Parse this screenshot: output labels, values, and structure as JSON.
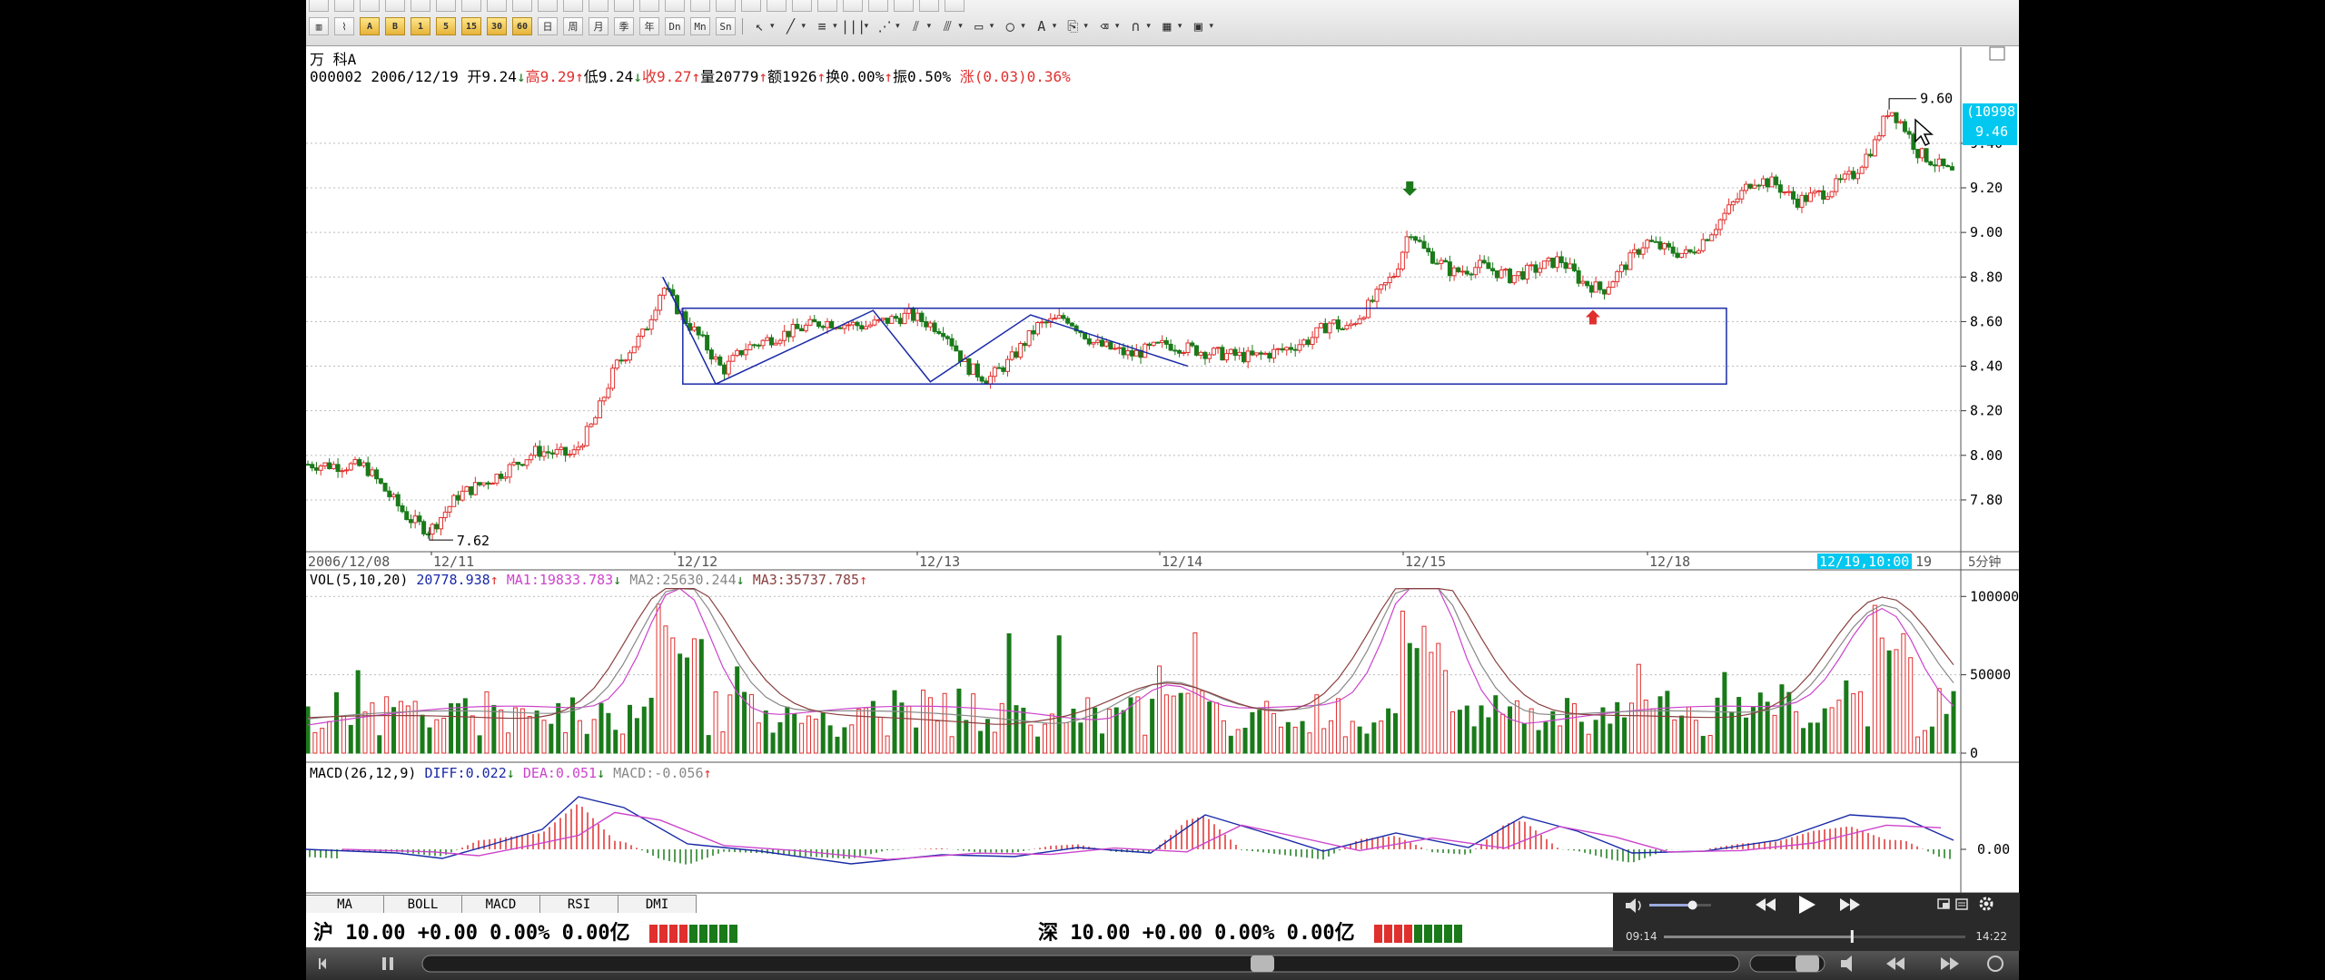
{
  "app": {
    "stock_name": "万 科A",
    "info_code_date": "000002 2006/12/19",
    "info_open": "开9.24",
    "info_high": "高9.29",
    "info_low": "低9.24",
    "info_close": "收9.27",
    "info_volume": "量20779",
    "info_amount": "额1926",
    "info_turnover": "换0.00%",
    "info_amplitude": "振0.50%",
    "info_change": "涨(0.03)0.36%"
  },
  "toolbar": {
    "row2_buttons": [
      "A",
      "B",
      "1",
      "5",
      "15",
      "30",
      "60",
      "日",
      "周",
      "月",
      "季",
      "年",
      "Dn",
      "Mn",
      "Sn"
    ]
  },
  "price_axis": {
    "ticks": [
      "9.40",
      "9.20",
      "9.00",
      "8.80",
      "8.60",
      "8.40",
      "8.20",
      "8.00",
      "7.80"
    ],
    "max_label": "9.60",
    "min_label": "7.62",
    "crosshair_count": "(10998)",
    "crosshair_price": "9.46"
  },
  "time_axis": {
    "start_label": "2006/12/08",
    "labels": [
      "12/11",
      "12/12",
      "12/13",
      "12/14",
      "12/15",
      "12/18"
    ],
    "highlight": "12/19,10:00",
    "tail_label": "19",
    "period": "5分钟"
  },
  "volume": {
    "indicator_name": "VOL(5,10,20)",
    "vol": "20778.938",
    "ma1": "MA1:19833.783",
    "ma2": "MA2:25630.244",
    "ma3": "MA3:35737.785",
    "ticks": [
      "100000",
      "50000",
      "0"
    ]
  },
  "macd": {
    "indicator_name": "MACD(26,12,9)",
    "diff": "DIFF:0.022",
    "dea": "DEA:0.051",
    "macd": "MACD:-0.056",
    "ticks": [
      "0.00"
    ]
  },
  "tabs": [
    "MA",
    "BOLL",
    "MACD",
    "RSI",
    "DMI"
  ],
  "status": {
    "sh_label": "沪 10.00 +0.00 0.00% 0.00亿",
    "sz_label": "深 10.00 +0.00 0.00% 0.00亿"
  },
  "player": {
    "current_time": "09:14",
    "total_time": "14:22",
    "progress": 0.62,
    "volume_level": 0.7
  },
  "chart_data": {
    "type": "candlestick",
    "price_range": [
      7.62,
      9.6
    ],
    "time_labels": [
      "12/11",
      "12/12",
      "12/13",
      "12/14",
      "12/15",
      "12/18",
      "12/19"
    ],
    "price_ticks": [
      9.4,
      9.2,
      9.0,
      8.8,
      8.6,
      8.4,
      8.2,
      8.0,
      7.8
    ],
    "volume_ticks": [
      100000,
      50000,
      0
    ],
    "macd_ticks": [
      0.0
    ],
    "key_points": [
      {
        "x": "12/11",
        "y": 7.62
      },
      {
        "x": "12/12",
        "y": 8.8
      },
      {
        "x": "12/15",
        "y": 9.04
      },
      {
        "x": "12/19",
        "y": 9.6
      }
    ]
  },
  "colors": {
    "up": "#e0302e",
    "down": "#1a7a1a",
    "box": "#1a2aa8",
    "ma1": "#cc44cc",
    "ma2": "#888888",
    "ma3": "#8a4040",
    "crosshair_bg": "#00c8f0"
  }
}
